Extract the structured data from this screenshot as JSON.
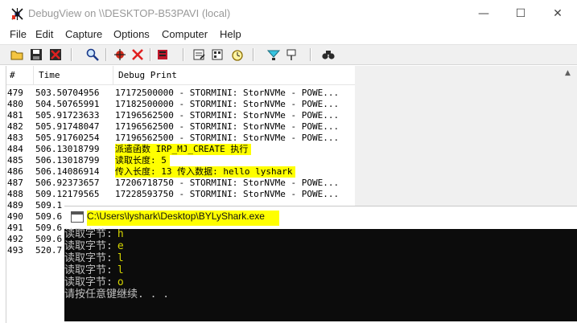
{
  "debugview": {
    "title": "DebugView on \\\\DESKTOP-B53PAVI (local)",
    "window_buttons": {
      "minimize": "—",
      "maximize": "☐",
      "close": "✕"
    },
    "menu": [
      "File",
      "Edit",
      "Capture",
      "Options",
      "Computer",
      "Help"
    ],
    "toolbar_icons": [
      "open-icon",
      "save-icon",
      "clear-icon",
      "find-icon",
      "capture-icon",
      "stop-capture-icon",
      "clear-display-icon",
      "edit-filter-icon",
      "history-depth-icon",
      "clock-icon",
      "highlight-icon",
      "filter-icon",
      "binoculars-icon"
    ],
    "columns": {
      "num": "#",
      "time": "Time",
      "message": "Debug Print"
    },
    "rows": [
      {
        "num": "479",
        "time": "503.50704956",
        "msg": "17172500000 - STORMINI: StorNVMe - POWE...",
        "highlight": false
      },
      {
        "num": "480",
        "time": "504.50765991",
        "msg": "17182500000 - STORMINI: StorNVMe - POWE...",
        "highlight": false
      },
      {
        "num": "481",
        "time": "505.91723633",
        "msg": "17196562500 - STORMINI: StorNVMe - POWE...",
        "highlight": false
      },
      {
        "num": "482",
        "time": "505.91748047",
        "msg": "17196562500 - STORMINI: StorNVMe - POWE...",
        "highlight": false
      },
      {
        "num": "483",
        "time": "505.91760254",
        "msg": "17196562500 - STORMINI: StorNVMe - POWE...",
        "highlight": false
      },
      {
        "num": "484",
        "time": "506.13018799",
        "msg": "派遣函数 IRP_MJ_CREATE 执行",
        "highlight": true
      },
      {
        "num": "485",
        "time": "506.13018799",
        "msg": "读取长度: 5",
        "highlight": true
      },
      {
        "num": "486",
        "time": "506.14086914",
        "msg": "传入长度: 13 传入数据: hello lyshark",
        "highlight": true
      },
      {
        "num": "487",
        "time": "506.92373657",
        "msg": "17206718750 - STORMINI: StorNVMe - POWE...",
        "highlight": false
      },
      {
        "num": "488",
        "time": "509.12179565",
        "msg": "17228593750 - STORMINI: StorNVMe - POWE...",
        "highlight": false
      },
      {
        "num": "489",
        "time": "509.1",
        "msg": "",
        "highlight": false
      },
      {
        "num": "490",
        "time": "509.6",
        "msg": "",
        "highlight": false
      },
      {
        "num": "491",
        "time": "509.6",
        "msg": "",
        "highlight": false
      },
      {
        "num": "492",
        "time": "509.6",
        "msg": "",
        "highlight": false
      },
      {
        "num": "493",
        "time": "520.7",
        "msg": "",
        "highlight": false
      }
    ]
  },
  "console": {
    "title": "C:\\Users\\lyshark\\Desktop\\BYLyShark.exe",
    "lines": [
      {
        "label": "读取字节:",
        "value": "h"
      },
      {
        "label": "读取字节:",
        "value": "e"
      },
      {
        "label": "读取字节:",
        "value": "l"
      },
      {
        "label": "读取字节:",
        "value": "l"
      },
      {
        "label": "读取字节:",
        "value": "o"
      }
    ],
    "prompt": "请按任意键继续. . ."
  },
  "colors": {
    "highlight": "#ffff00",
    "console_bg": "#0c0c0c",
    "console_char": "#d6d600"
  }
}
